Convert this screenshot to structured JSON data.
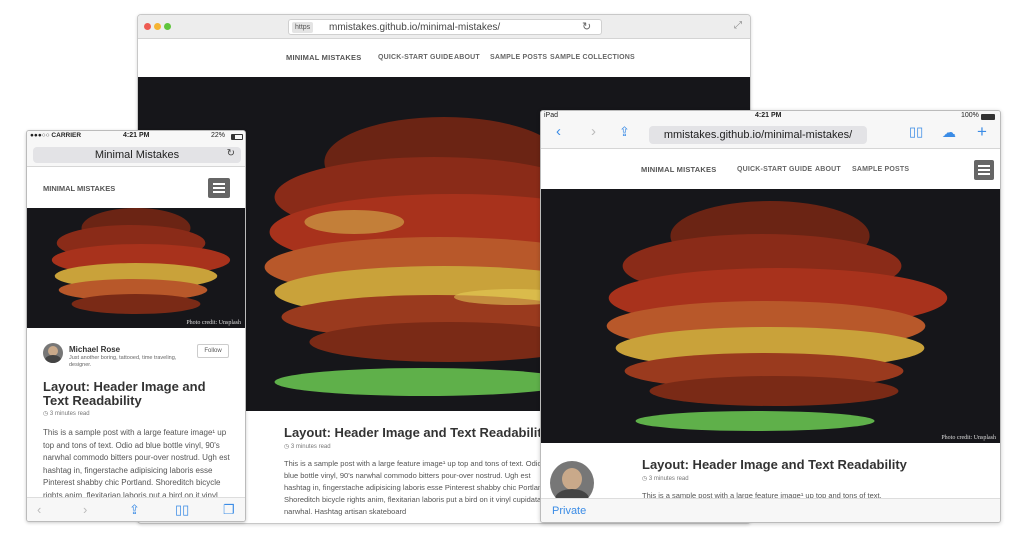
{
  "desktop": {
    "url_badge": "https",
    "url": "mmistakes.github.io/minimal-mistakes/",
    "nav": {
      "brand": "MINIMAL MISTAKES",
      "items": [
        "QUICK-START GUIDE",
        "ABOUT",
        "SAMPLE POSTS",
        "SAMPLE COLLECTIONS"
      ]
    },
    "post": {
      "title": "Layout: Header Image and Text Readability",
      "meta": "3 minutes read",
      "body": "This is a sample post with a large feature image¹ up top and tons of text. Odio ad blue bottle vinyl, 90's narwhal commodo bitters pour-over nostrud. Ugh est hashtag in, fingerstache adipisicing laboris esse Pinterest shabby chic Portland. Shoreditch bicycle rights anim, flexitarian laboris put a bird on it vinyl cupidatat narwhal. Hashtag artisan skateboard"
    }
  },
  "phone": {
    "status": {
      "carrier": "●●●○○ CARRIER",
      "time": "4:21 PM",
      "battery": "22%"
    },
    "url_title": "Minimal Mistakes",
    "nav": {
      "brand": "MINIMAL MISTAKES"
    },
    "photo_credit": "Photo credit: Unsplash",
    "author": {
      "name": "Michael Rose",
      "bio": "Just another boring, tattooed, time traveling, designer.",
      "follow": "Follow"
    },
    "post": {
      "title": "Layout: Header Image and Text Readability",
      "meta": "3 minutes read",
      "body": "This is a sample post with a large feature image¹ up top and tons of text. Odio ad blue bottle vinyl, 90's narwhal commodo bitters pour-over nostrud. Ugh est hashtag in, fingerstache adipisicing laboris esse Pinterest shabby chic Portland. Shoreditch bicycle rights anim, flexitarian laboris put a bird on it vinyl"
    }
  },
  "tablet": {
    "status": {
      "device": "iPad",
      "time": "4:21 PM",
      "battery": "100%"
    },
    "url": "mmistakes.github.io/minimal-mistakes/",
    "nav": {
      "brand": "MINIMAL MISTAKES",
      "items": [
        "QUICK-START GUIDE",
        "ABOUT",
        "SAMPLE POSTS"
      ]
    },
    "photo_credit": "Photo credit: Unsplash",
    "post": {
      "title": "Layout: Header Image and Text Readability",
      "meta": "3 minutes read",
      "body": "This is a sample post with a large feature image¹ up top and tons of text."
    },
    "private_label": "Private"
  },
  "colors": {
    "accent": "#3b8ce6",
    "hero_bg": "#16161a",
    "leaf_red": "#a8321c",
    "leaf_yellow": "#c9a23a",
    "leaf_green": "#5fb04a"
  },
  "icons": [
    "reload-icon",
    "expand-icon",
    "hamburger-icon",
    "back-icon",
    "forward-icon",
    "share-icon",
    "bookmarks-icon",
    "tabs-icon",
    "cloud-icon",
    "plus-icon",
    "clock-icon"
  ]
}
